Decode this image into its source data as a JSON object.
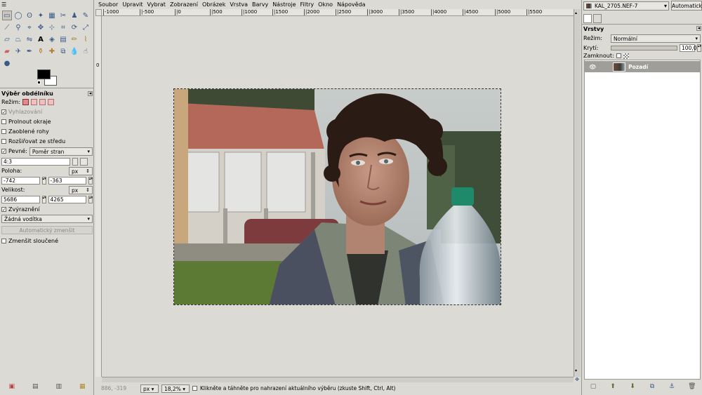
{
  "menubar": [
    "Soubor",
    "Upravit",
    "Vybrat",
    "Zobrazení",
    "Obrázek",
    "Vrstva",
    "Barvy",
    "Nástroje",
    "Filtry",
    "Okno",
    "Nápověda"
  ],
  "ruler": {
    "h_labels": [
      "-1000",
      "|-500",
      "|0",
      "|500",
      "|1000",
      "|1500",
      "|2000",
      "|2500",
      "|3000",
      "|3500",
      "|4000",
      "|4500",
      "|5000",
      "|5500"
    ],
    "v_label": "0"
  },
  "toolbox": {
    "tools": [
      "rect-select",
      "ellipse-select",
      "free-select",
      "fuzzy-select",
      "color-select",
      "scissors",
      "foreground-select",
      "paths",
      "color-picker",
      "zoom",
      "measure",
      "move",
      "align",
      "crop",
      "rotate",
      "scale",
      "shear",
      "perspective",
      "flip",
      "text",
      "bucket-fill",
      "blend",
      "pencil",
      "paintbrush",
      "eraser",
      "airbrush",
      "ink",
      "clone",
      "heal",
      "perspective-clone",
      "blur",
      "smudge",
      "dodge-burn"
    ],
    "options": {
      "title": "Výběr obdélníku",
      "mode_label": "Režim:",
      "antialias": "Vyhlazování",
      "feather": "Prolnout okraje",
      "rounded": "Zaoblené rohy",
      "expand_center": "Rozšiřovat ze středu",
      "fixed": "Pevné:",
      "fixed_combo": "Poměr stran",
      "ratio": "4:3",
      "position_label": "Poloha:",
      "position_unit": "px",
      "pos_x": "-742",
      "pos_y": "-363",
      "size_label": "Velikost:",
      "size_unit": "px",
      "size_w": "5686",
      "size_h": "4265",
      "highlight": "Zvýraznění",
      "guides": "Žádná vodítka",
      "autoshrink": "Automatický zmenšit",
      "shrink_merged": "Zmenšit sloučené"
    }
  },
  "status": {
    "coords": "886, -319",
    "unit": "px",
    "zoom": "18,2%",
    "message": "Klikněte a táhněte pro nahrazení aktuálního výběru (zkuste Shift, Ctrl, Alt)"
  },
  "dock": {
    "image_name": "KAL_2705.NEF-7",
    "auto_button": "Automaticky",
    "title": "Vrstvy",
    "mode_label": "Režim:",
    "mode": "Normální",
    "opacity_label": "Krytí:",
    "opacity": "100,0",
    "lock_label": "Zamknout:",
    "layer_name": "Pozadí"
  }
}
